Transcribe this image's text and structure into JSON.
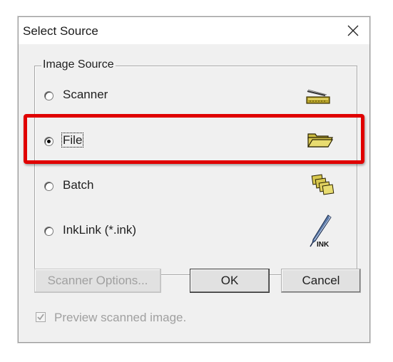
{
  "window": {
    "title": "Select Source"
  },
  "group": {
    "label": "Image Source",
    "options": [
      {
        "label": "Scanner",
        "checked": false,
        "icon": "scanner-icon"
      },
      {
        "label": "File",
        "checked": true,
        "icon": "folder-open-icon"
      },
      {
        "label": "Batch",
        "checked": false,
        "icon": "batch-icon"
      },
      {
        "label": "InkLink (*.ink)",
        "checked": false,
        "icon": "inklink-icon"
      }
    ]
  },
  "buttons": {
    "scanner_options": "Scanner Options...",
    "ok": "OK",
    "cancel": "Cancel"
  },
  "preview_checkbox": {
    "label": "Preview scanned image.",
    "checked": true,
    "enabled": false
  },
  "colors": {
    "highlight": "#e00000",
    "dialog_bg": "#f0f0f0",
    "disabled_text": "#a0a0a0"
  }
}
